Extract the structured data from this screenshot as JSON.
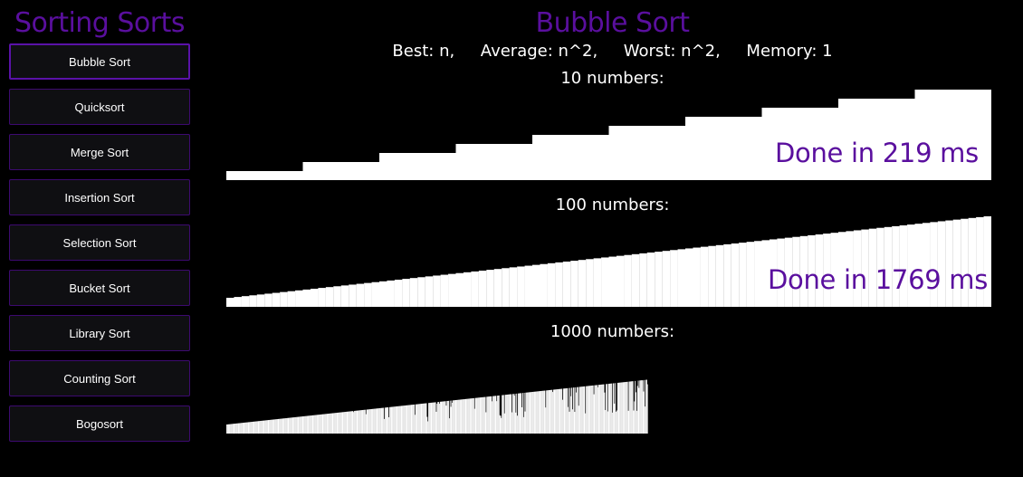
{
  "sidebar": {
    "title": "Sorting Sorts",
    "items": [
      {
        "label": "Bubble Sort",
        "active": true
      },
      {
        "label": "Quicksort",
        "active": false
      },
      {
        "label": "Merge Sort",
        "active": false
      },
      {
        "label": "Insertion Sort",
        "active": false
      },
      {
        "label": "Selection Sort",
        "active": false
      },
      {
        "label": "Bucket Sort",
        "active": false
      },
      {
        "label": "Library Sort",
        "active": false
      },
      {
        "label": "Counting Sort",
        "active": false
      },
      {
        "label": "Bogosort",
        "active": false
      }
    ]
  },
  "main": {
    "title": "Bubble Sort",
    "complexity": "Best: n,     Average: n^2,     Worst: n^2,     Memory: 1",
    "runs": [
      {
        "label": "10 numbers:",
        "count": 10,
        "done_text": "Done in 219 ms",
        "progress": 1.0
      },
      {
        "label": "100 numbers:",
        "count": 100,
        "done_text": "Done in 1769 ms",
        "progress": 1.0
      },
      {
        "label": "1000 numbers:",
        "count": 1000,
        "done_text": "",
        "progress": 0.55
      }
    ]
  },
  "colors": {
    "accent": "#5a0f9e",
    "button_bg": "#0f0f12",
    "button_border": "#3d0a70",
    "bar": "#ffffff",
    "background": "#000000"
  }
}
